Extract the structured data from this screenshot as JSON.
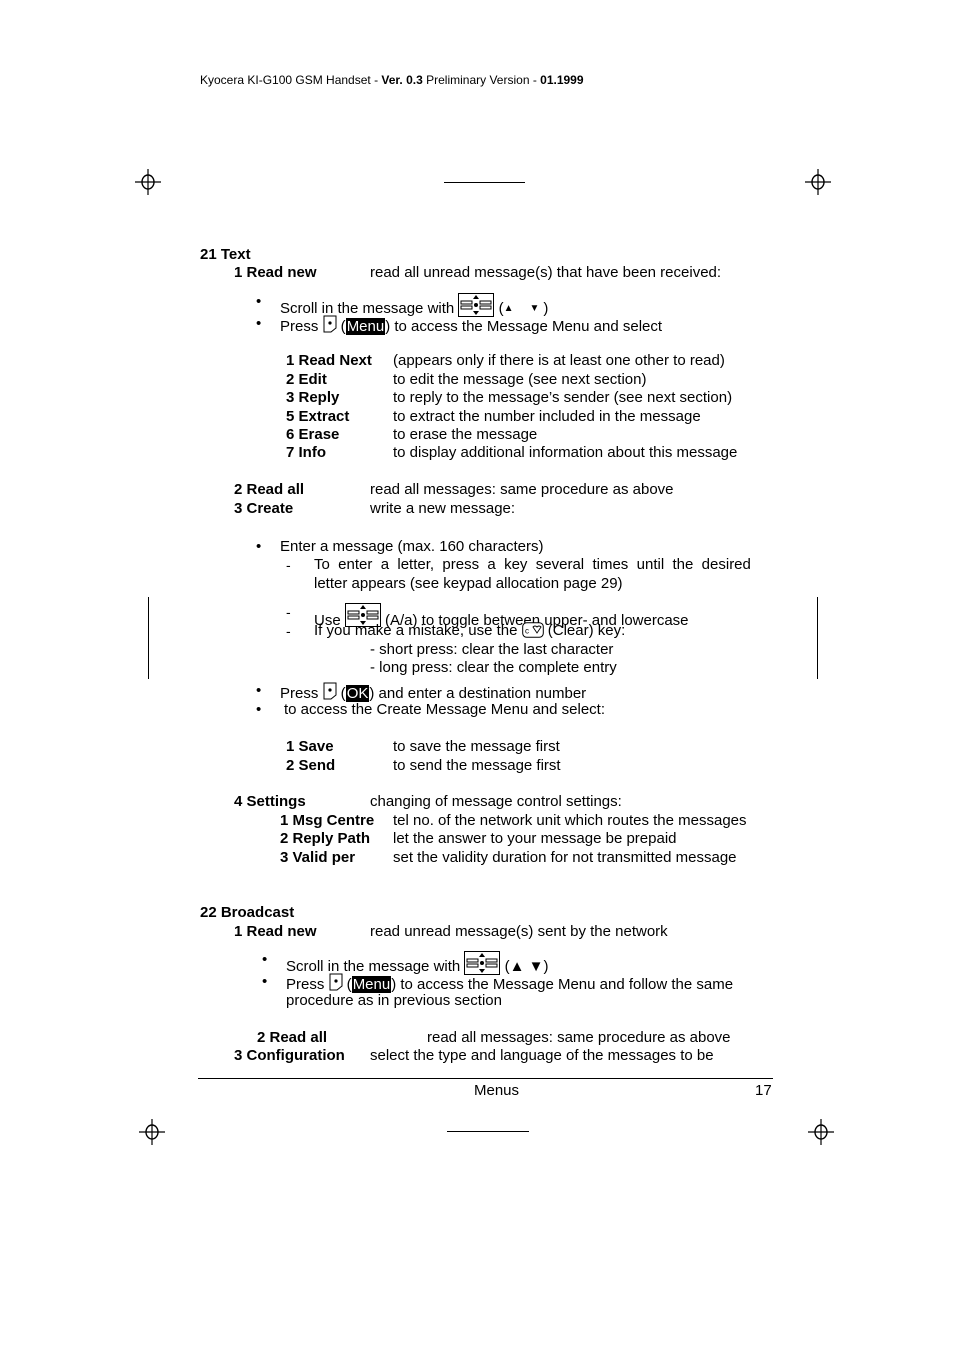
{
  "header": {
    "prefix": "Kyocera KI-G100 GSM Handset - ",
    "version": "Ver. 0.3",
    "middle": " Preliminary Version - ",
    "date": "01.1999"
  },
  "icons": {
    "registration_mark": "crosshair-circle",
    "nav_key": "navigation-key-icon",
    "soft_key": "soft-key-icon",
    "clear_key": "clear-key-icon",
    "arrow_up": "▲",
    "arrow_down": "▼"
  },
  "text_section": {
    "title": "21 Text",
    "read_new": {
      "label": "1 Read new",
      "desc": "read all unread message(s) that have been received:",
      "bullet1_pre": "Scroll in the message with ",
      "bullet1_open": " (",
      "bullet1_close": ")",
      "bullet2_pre": "Press ",
      "bullet2_paren_open": " (",
      "bullet2_key": "Menu",
      "bullet2_post": ") to access the Message Menu and select",
      "menu": [
        {
          "label": "1 Read Next",
          "desc": "(appears only if there is at least one other to read)"
        },
        {
          "label": "2 Edit",
          "desc": "to edit the message (see next section)"
        },
        {
          "label": "3 Reply",
          "desc": "to reply to the message’s sender (see next section)"
        },
        {
          "label": "5 Extract",
          "desc": "to extract the number included in the message"
        },
        {
          "label": "6 Erase",
          "desc": "to erase the message"
        },
        {
          "label": "7 Info",
          "desc": "to display additional information about this message"
        }
      ]
    },
    "read_all": {
      "label": "2 Read all",
      "desc": "read all messages: same procedure as above"
    },
    "create": {
      "label": "3 Create",
      "desc": "write a new message:",
      "bullet1": "Enter a message (max. 160 characters)",
      "sub1_line1": "To  enter  a  letter,  press  a  key  several  times  until  the  desired",
      "sub1_line2": "letter appears (see keypad allocation page 29)",
      "sub2_pre": "Use ",
      "sub2_post": " (A/a) to toggle between upper- and lowercase",
      "sub3_pre": "If you make a mistake, use the ",
      "sub3_post": " (Clear) key:",
      "short_press": "- short press: clear the last character",
      "long_press": "- long press: clear the complete entry",
      "bullet2_pre": "Press ",
      "bullet2_paren_open": " (",
      "bullet2_key": "OK",
      "bullet2_post": ") and enter a destination number",
      "bullet3": "to access the Create Message Menu and select:",
      "menu": [
        {
          "label": "1 Save",
          "desc": "to save the message first"
        },
        {
          "label": "2 Send",
          "desc": "to send the message first"
        }
      ]
    },
    "settings": {
      "label": "4 Settings",
      "desc": "changing of message control settings:",
      "items": [
        {
          "label": "1 Msg Centre",
          "desc": "tel no. of the network unit which routes the messages"
        },
        {
          "label": "2 Reply Path",
          "desc": "let the answer to your message be prepaid"
        },
        {
          "label": "3 Valid per",
          "desc": "set the validity duration for not transmitted message"
        }
      ]
    }
  },
  "broadcast_section": {
    "title": "22 Broadcast",
    "read_new": {
      "label": "1 Read new",
      "desc": "read unread message(s) sent by the network",
      "bullet1_pre": "Scroll in the message with ",
      "bullet1_arrows": " (▲ ▼)",
      "bullet2_pre": "Press ",
      "bullet2_paren_open": " (",
      "bullet2_key": "Menu",
      "bullet2_post": ") to access the Message Menu and follow the same",
      "bullet2_line2": "procedure as in previous section"
    },
    "read_all": {
      "label": "2 Read all",
      "desc": "read all messages: same procedure as above"
    },
    "configuration": {
      "label": "3 Configuration",
      "desc": "select the type and language of the messages to be"
    }
  },
  "footer": {
    "section": "Menus",
    "page_number": "17"
  }
}
